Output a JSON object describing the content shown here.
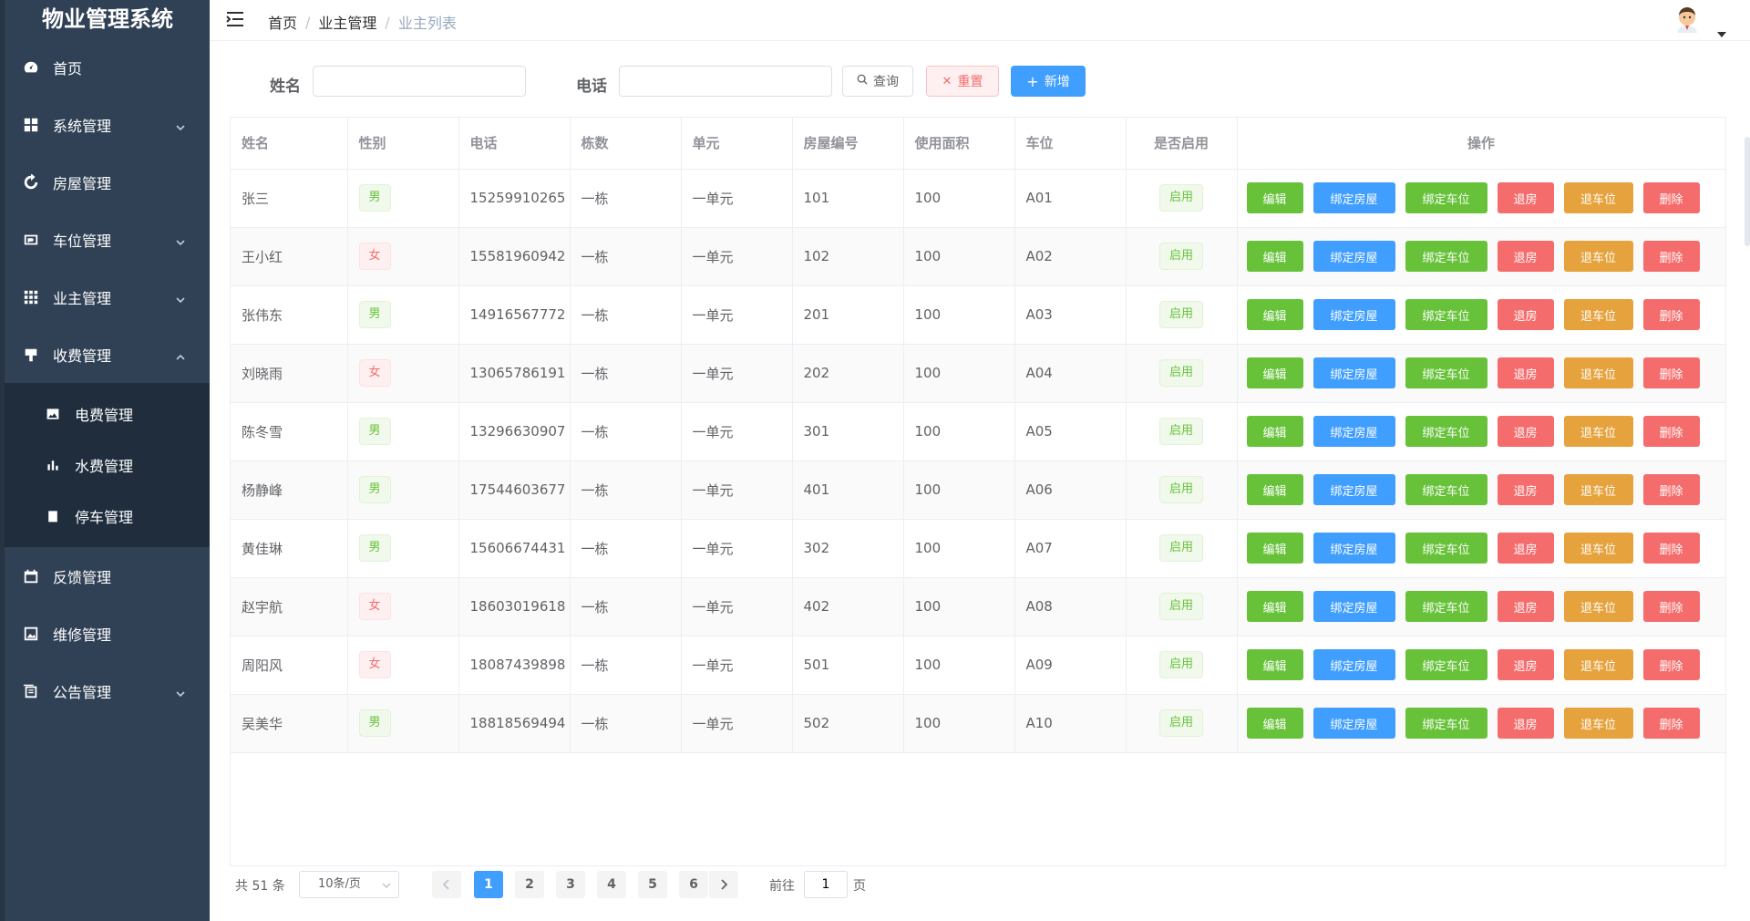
{
  "app": {
    "title": "物业管理系统"
  },
  "sidebar": {
    "items": [
      {
        "label": "首页",
        "icon": "dashboard-icon"
      },
      {
        "label": "系统管理",
        "icon": "grid-icon",
        "arrow": "down"
      },
      {
        "label": "房屋管理",
        "icon": "refresh-icon"
      },
      {
        "label": "车位管理",
        "icon": "parking-icon",
        "arrow": "down"
      },
      {
        "label": "业主管理",
        "icon": "apps-icon",
        "arrow": "down"
      },
      {
        "label": "收费管理",
        "icon": "payment-icon",
        "arrow": "up"
      }
    ],
    "submenu": [
      {
        "label": "电费管理",
        "icon": "image-icon"
      },
      {
        "label": "水费管理",
        "icon": "chart-icon"
      },
      {
        "label": "停车管理",
        "icon": "clipboard-icon"
      }
    ],
    "items_after": [
      {
        "label": "反馈管理",
        "icon": "calendar-icon"
      },
      {
        "label": "维修管理",
        "icon": "picture-icon"
      },
      {
        "label": "公告管理",
        "icon": "notice-icon",
        "arrow": "down"
      }
    ]
  },
  "header": {
    "breadcrumb": [
      "首页",
      "业主管理",
      "业主列表"
    ]
  },
  "search": {
    "name_label": "姓名",
    "name_value": "",
    "phone_label": "电话",
    "phone_value": "",
    "query_label": "查询",
    "reset_label": "重置",
    "add_label": "新增"
  },
  "table": {
    "columns": [
      "姓名",
      "性别",
      "电话",
      "栋数",
      "单元",
      "房屋编号",
      "使用面积",
      "车位",
      "是否启用",
      "操作"
    ],
    "actions": [
      "编辑",
      "绑定房屋",
      "绑定车位",
      "退房",
      "退车位",
      "删除"
    ],
    "rows": [
      {
        "name": "张三",
        "gender": "男",
        "phone": "15259910265",
        "building": "一栋",
        "unit": "一单元",
        "room": "101",
        "area": "100",
        "parking": "A01",
        "enabled": "启用"
      },
      {
        "name": "王小红",
        "gender": "女",
        "phone": "15581960942",
        "building": "一栋",
        "unit": "一单元",
        "room": "102",
        "area": "100",
        "parking": "A02",
        "enabled": "启用"
      },
      {
        "name": "张伟东",
        "gender": "男",
        "phone": "14916567772",
        "building": "一栋",
        "unit": "一单元",
        "room": "201",
        "area": "100",
        "parking": "A03",
        "enabled": "启用"
      },
      {
        "name": "刘晓雨",
        "gender": "女",
        "phone": "13065786191",
        "building": "一栋",
        "unit": "一单元",
        "room": "202",
        "area": "100",
        "parking": "A04",
        "enabled": "启用"
      },
      {
        "name": "陈冬雪",
        "gender": "男",
        "phone": "13296630907",
        "building": "一栋",
        "unit": "一单元",
        "room": "301",
        "area": "100",
        "parking": "A05",
        "enabled": "启用"
      },
      {
        "name": "杨静峰",
        "gender": "男",
        "phone": "17544603677",
        "building": "一栋",
        "unit": "一单元",
        "room": "401",
        "area": "100",
        "parking": "A06",
        "enabled": "启用"
      },
      {
        "name": "黄佳琳",
        "gender": "男",
        "phone": "15606674431",
        "building": "一栋",
        "unit": "一单元",
        "room": "302",
        "area": "100",
        "parking": "A07",
        "enabled": "启用"
      },
      {
        "name": "赵宇航",
        "gender": "女",
        "phone": "18603019618",
        "building": "一栋",
        "unit": "一单元",
        "room": "402",
        "area": "100",
        "parking": "A08",
        "enabled": "启用"
      },
      {
        "name": "周阳风",
        "gender": "女",
        "phone": "18087439898",
        "building": "一栋",
        "unit": "一单元",
        "room": "501",
        "area": "100",
        "parking": "A09",
        "enabled": "启用"
      },
      {
        "name": "吴美华",
        "gender": "男",
        "phone": "18818569494",
        "building": "一栋",
        "unit": "一单元",
        "room": "502",
        "area": "100",
        "parking": "A10",
        "enabled": "启用"
      }
    ]
  },
  "pagination": {
    "total_label": "共 51 条",
    "page_size_label": "10条/页",
    "pages": [
      "1",
      "2",
      "3",
      "4",
      "5",
      "6"
    ],
    "current_page": "1",
    "goto_prefix": "前往",
    "goto_value": "1",
    "goto_suffix": "页"
  },
  "colors": {
    "sidebar_bg": "#304156",
    "submenu_bg": "#1f2d3d",
    "primary": "#409eff",
    "success": "#67c23a",
    "danger": "#f56c6c",
    "warning": "#e6a23c"
  }
}
